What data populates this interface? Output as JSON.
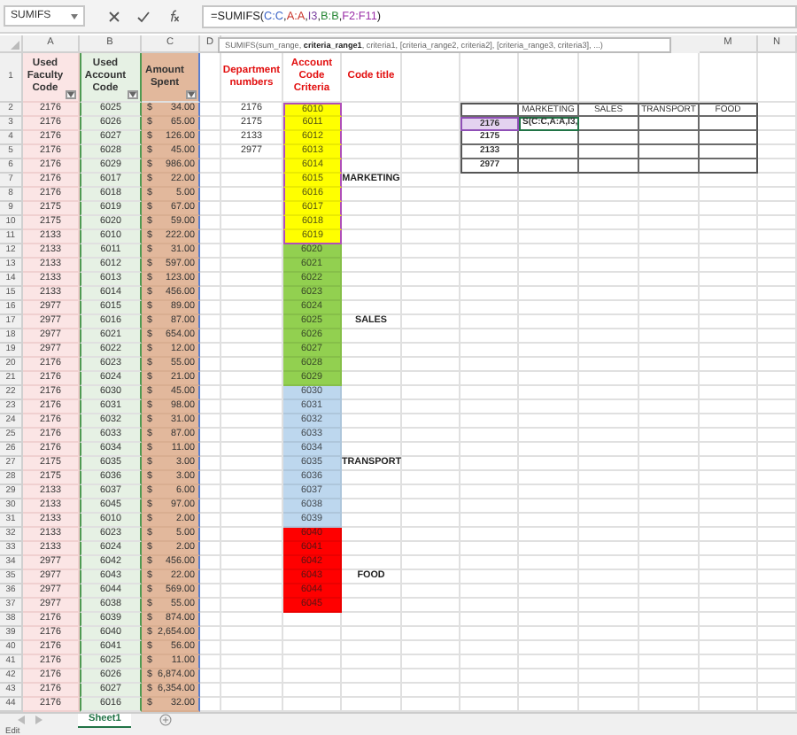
{
  "name_box": {
    "value": "SUMIFS"
  },
  "formula": {
    "tokens": [
      {
        "text": "=SUMIFS("
      },
      {
        "text": "C:C",
        "color": "#3a63c6"
      },
      {
        "text": ","
      },
      {
        "text": "A:A",
        "color": "#c8342a"
      },
      {
        "text": ","
      },
      {
        "text": "I3",
        "color": "#7a3fa0"
      },
      {
        "text": ","
      },
      {
        "text": "B:B",
        "color": "#2e8a3c"
      },
      {
        "text": ","
      },
      {
        "text": "F2:F11",
        "color": "#9b2fa8"
      },
      {
        "text": ")"
      }
    ]
  },
  "tooltip": "SUMIFS(sum_range, **criteria_range1**, criteria1, [criteria_range2, criteria2], [criteria_range3, criteria3], ...)",
  "columns": [
    "A",
    "B",
    "C",
    "D",
    "M",
    "N"
  ],
  "header_row": {
    "row": "1",
    "faculty": "Used Faculty Code",
    "account": "Used Account Code",
    "amount": "Amount Spent",
    "department": "Department numbers",
    "criteria": "Account Code Criteria",
    "title": "Code title"
  },
  "data_rows": [
    {
      "row": "2",
      "faculty": "2176",
      "account": "6025",
      "currency": "$",
      "amount": "34.00"
    },
    {
      "row": "3",
      "faculty": "2176",
      "account": "6026",
      "currency": "$",
      "amount": "65.00"
    },
    {
      "row": "4",
      "faculty": "2176",
      "account": "6027",
      "currency": "$",
      "amount": "126.00"
    },
    {
      "row": "5",
      "faculty": "2176",
      "account": "6028",
      "currency": "$",
      "amount": "45.00"
    },
    {
      "row": "6",
      "faculty": "2176",
      "account": "6029",
      "currency": "$",
      "amount": "986.00"
    },
    {
      "row": "7",
      "faculty": "2176",
      "account": "6017",
      "currency": "$",
      "amount": "22.00"
    },
    {
      "row": "8",
      "faculty": "2176",
      "account": "6018",
      "currency": "$",
      "amount": "5.00"
    },
    {
      "row": "9",
      "faculty": "2175",
      "account": "6019",
      "currency": "$",
      "amount": "67.00"
    },
    {
      "row": "10",
      "faculty": "2175",
      "account": "6020",
      "currency": "$",
      "amount": "59.00"
    },
    {
      "row": "11",
      "faculty": "2133",
      "account": "6010",
      "currency": "$",
      "amount": "222.00"
    },
    {
      "row": "12",
      "faculty": "2133",
      "account": "6011",
      "currency": "$",
      "amount": "31.00"
    },
    {
      "row": "13",
      "faculty": "2133",
      "account": "6012",
      "currency": "$",
      "amount": "597.00"
    },
    {
      "row": "14",
      "faculty": "2133",
      "account": "6013",
      "currency": "$",
      "amount": "123.00"
    },
    {
      "row": "15",
      "faculty": "2133",
      "account": "6014",
      "currency": "$",
      "amount": "456.00"
    },
    {
      "row": "16",
      "faculty": "2977",
      "account": "6015",
      "currency": "$",
      "amount": "89.00"
    },
    {
      "row": "17",
      "faculty": "2977",
      "account": "6016",
      "currency": "$",
      "amount": "87.00"
    },
    {
      "row": "18",
      "faculty": "2977",
      "account": "6021",
      "currency": "$",
      "amount": "654.00"
    },
    {
      "row": "19",
      "faculty": "2977",
      "account": "6022",
      "currency": "$",
      "amount": "12.00"
    },
    {
      "row": "20",
      "faculty": "2176",
      "account": "6023",
      "currency": "$",
      "amount": "55.00"
    },
    {
      "row": "21",
      "faculty": "2176",
      "account": "6024",
      "currency": "$",
      "amount": "21.00"
    },
    {
      "row": "22",
      "faculty": "2176",
      "account": "6030",
      "currency": "$",
      "amount": "45.00"
    },
    {
      "row": "23",
      "faculty": "2176",
      "account": "6031",
      "currency": "$",
      "amount": "98.00"
    },
    {
      "row": "24",
      "faculty": "2176",
      "account": "6032",
      "currency": "$",
      "amount": "31.00"
    },
    {
      "row": "25",
      "faculty": "2176",
      "account": "6033",
      "currency": "$",
      "amount": "87.00"
    },
    {
      "row": "26",
      "faculty": "2176",
      "account": "6034",
      "currency": "$",
      "amount": "11.00"
    },
    {
      "row": "27",
      "faculty": "2175",
      "account": "6035",
      "currency": "$",
      "amount": "3.00"
    },
    {
      "row": "28",
      "faculty": "2175",
      "account": "6036",
      "currency": "$",
      "amount": "3.00"
    },
    {
      "row": "29",
      "faculty": "2133",
      "account": "6037",
      "currency": "$",
      "amount": "6.00"
    },
    {
      "row": "30",
      "faculty": "2133",
      "account": "6045",
      "currency": "$",
      "amount": "97.00"
    },
    {
      "row": "31",
      "faculty": "2133",
      "account": "6010",
      "currency": "$",
      "amount": "2.00"
    },
    {
      "row": "32",
      "faculty": "2133",
      "account": "6023",
      "currency": "$",
      "amount": "5.00"
    },
    {
      "row": "33",
      "faculty": "2133",
      "account": "6024",
      "currency": "$",
      "amount": "2.00"
    },
    {
      "row": "34",
      "faculty": "2977",
      "account": "6042",
      "currency": "$",
      "amount": "456.00"
    },
    {
      "row": "35",
      "faculty": "2977",
      "account": "6043",
      "currency": "$",
      "amount": "22.00"
    },
    {
      "row": "36",
      "faculty": "2977",
      "account": "6044",
      "currency": "$",
      "amount": "569.00"
    },
    {
      "row": "37",
      "faculty": "2977",
      "account": "6038",
      "currency": "$",
      "amount": "55.00"
    },
    {
      "row": "38",
      "faculty": "2176",
      "account": "6039",
      "currency": "$",
      "amount": "874.00"
    },
    {
      "row": "39",
      "faculty": "2176",
      "account": "6040",
      "currency": "$",
      "amount": "2,654.00"
    },
    {
      "row": "40",
      "faculty": "2176",
      "account": "6041",
      "currency": "$",
      "amount": "56.00"
    },
    {
      "row": "41",
      "faculty": "2176",
      "account": "6025",
      "currency": "$",
      "amount": "11.00"
    },
    {
      "row": "42",
      "faculty": "2176",
      "account": "6026",
      "currency": "$",
      "amount": "6,874.00"
    },
    {
      "row": "43",
      "faculty": "2176",
      "account": "6027",
      "currency": "$",
      "amount": "6,354.00"
    },
    {
      "row": "44",
      "faculty": "2176",
      "account": "6016",
      "currency": "$",
      "amount": "32.00"
    }
  ],
  "department_numbers": [
    "2176",
    "2175",
    "2133",
    "2977"
  ],
  "criteria_groups": [
    {
      "title": "MARKETING",
      "color": "#ffff00",
      "referenced": true,
      "codes": [
        "6010",
        "6011",
        "6012",
        "6013",
        "6014",
        "6015",
        "6016",
        "6017",
        "6018",
        "6019"
      ]
    },
    {
      "title": "SALES",
      "color": "#92d050",
      "referenced": false,
      "codes": [
        "6020",
        "6021",
        "6022",
        "6023",
        "6024",
        "6025",
        "6026",
        "6027",
        "6028",
        "6029"
      ]
    },
    {
      "title": "TRANSPORT",
      "color": "#bdd7ee",
      "referenced": false,
      "codes": [
        "6030",
        "6031",
        "6032",
        "6033",
        "6034",
        "6035",
        "6036",
        "6037",
        "6038",
        "6039"
      ]
    },
    {
      "title": "FOOD",
      "color": "#ff0000",
      "referenced": false,
      "codes": [
        "6040",
        "6041",
        "6042",
        "6043",
        "6044",
        "6045"
      ]
    }
  ],
  "summary": {
    "headers": [
      "MARKETING",
      "SALES",
      "TRANSPORT",
      "FOOD"
    ],
    "rows": [
      {
        "label": "2176",
        "referenced": true,
        "entry": "S(C:C,A:A,I3,"
      },
      {
        "label": "2175",
        "referenced": false
      },
      {
        "label": "2133",
        "referenced": false
      },
      {
        "label": "2977",
        "referenced": false
      }
    ]
  },
  "sheet_tabs": [
    {
      "label": "Sheet1",
      "selected": true
    }
  ],
  "status_bar": {
    "mode": "Edit"
  }
}
